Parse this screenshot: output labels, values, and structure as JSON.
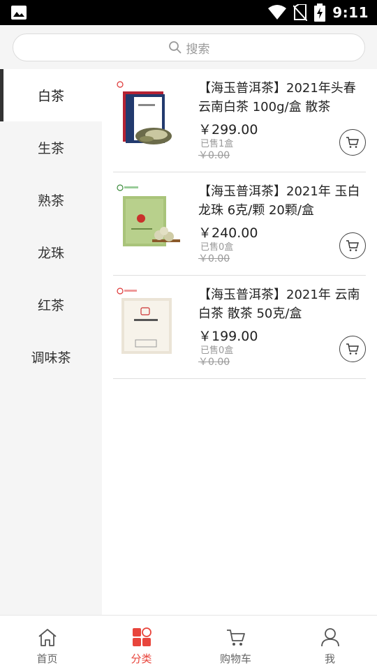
{
  "status_bar": {
    "time": "9:11"
  },
  "search": {
    "placeholder": "搜索"
  },
  "sidebar": {
    "items": [
      {
        "label": "白茶",
        "active": true
      },
      {
        "label": "生茶"
      },
      {
        "label": "熟茶"
      },
      {
        "label": "龙珠"
      },
      {
        "label": "红茶"
      },
      {
        "label": "调味茶"
      }
    ]
  },
  "products": [
    {
      "title": "【海玉普洱茶】2021年头春云南白茶 100g/盒 散茶",
      "price": "￥299.00",
      "sold": "已售1盒",
      "old_price": "￥0.00"
    },
    {
      "title": "【海玉普洱茶】2021年 玉白 龙珠 6克/颗 20颗/盒",
      "price": "￥240.00",
      "sold": "已售0盒",
      "old_price": "￥0.00"
    },
    {
      "title": "【海玉普洱茶】2021年 云南白茶 散茶 50克/盒",
      "price": "￥199.00",
      "sold": "已售0盒",
      "old_price": "￥0.00"
    }
  ],
  "bottom_nav": {
    "items": [
      {
        "label": "首页",
        "icon": "home-icon"
      },
      {
        "label": "分类",
        "icon": "category-icon",
        "active": true
      },
      {
        "label": "购物车",
        "icon": "cart-icon"
      },
      {
        "label": "我",
        "icon": "user-icon"
      }
    ]
  },
  "colors": {
    "accent": "#e8453c",
    "sidebar_bg": "#f5f5f5",
    "active_bar": "#333333"
  }
}
